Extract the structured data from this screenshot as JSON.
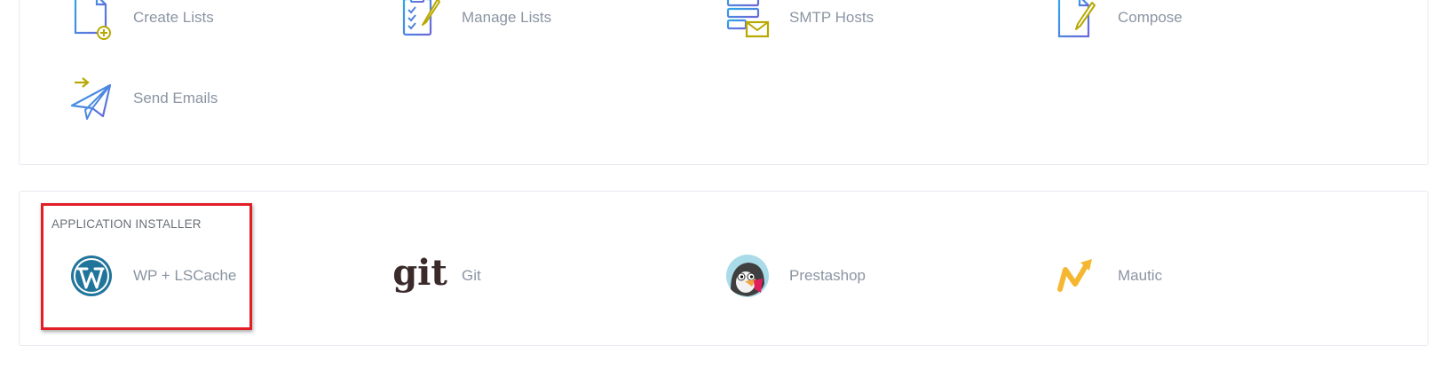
{
  "email_section": {
    "items": [
      {
        "label": "Create Lists",
        "icon": "create-list-icon"
      },
      {
        "label": "Manage Lists",
        "icon": "manage-list-icon"
      },
      {
        "label": "SMTP Hosts",
        "icon": "smtp-hosts-icon"
      },
      {
        "label": "Compose",
        "icon": "compose-icon"
      },
      {
        "label": "Send Emails",
        "icon": "send-email-icon"
      }
    ]
  },
  "app_section": {
    "title": "APPLICATION INSTALLER",
    "items": [
      {
        "label": "WP + LSCache",
        "icon": "wordpress-icon"
      },
      {
        "label": "Git",
        "icon": "git-icon",
        "icon_text": "git"
      },
      {
        "label": "Prestashop",
        "icon": "prestashop-icon"
      },
      {
        "label": "Mautic",
        "icon": "mautic-icon"
      }
    ]
  },
  "colors": {
    "icon_blue": "#3a8ee6",
    "icon_accent": "#b8a800",
    "wordpress": "#21759b",
    "mautic": "#f5b731",
    "highlight": "#e21f26",
    "label": "#8a95a3"
  }
}
